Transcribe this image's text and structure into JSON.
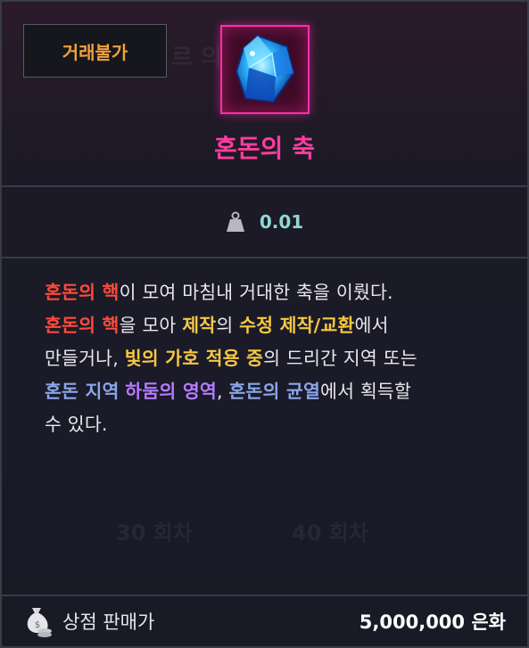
{
  "header": {
    "trade_badge": "거래불가",
    "item_name": "혼돈의 축",
    "item_icon": "blue-crystal-icon"
  },
  "colors": {
    "item_name": "#ff3c9e",
    "trade_badge": "#f0a23a",
    "weight": "#8fd8d6",
    "red_link": "#ff4a3a",
    "gold": "#f5c842",
    "chaos_blue": "#8aa6e8",
    "purple": "#b57cff"
  },
  "weight": {
    "icon": "weight-icon",
    "value": "0.01"
  },
  "description": [
    [
      {
        "text": "혼돈의 핵",
        "style": "red"
      },
      {
        "text": "이 모여 마침내 거대한 축을 이뤘다.",
        "style": "plain"
      }
    ],
    [
      {
        "text": "혼돈의 핵",
        "style": "red"
      },
      {
        "text": "을 모아 ",
        "style": "plain"
      },
      {
        "text": "제작",
        "style": "gold"
      },
      {
        "text": "의 ",
        "style": "plain"
      },
      {
        "text": "수정 제작/교환",
        "style": "gold"
      },
      {
        "text": "에서",
        "style": "plain"
      }
    ],
    [
      {
        "text": "만들거나, ",
        "style": "plain"
      },
      {
        "text": "빛의 가호 적용 중",
        "style": "gold"
      },
      {
        "text": "의 드리간 지역 또는",
        "style": "plain"
      }
    ],
    [
      {
        "text": "혼돈 지역",
        "style": "blue"
      },
      {
        "text": " ",
        "style": "plain"
      },
      {
        "text": "하둠의 영역",
        "style": "purple"
      },
      {
        "text": ", ",
        "style": "plain"
      },
      {
        "text": "혼돈의 균열",
        "style": "blue"
      },
      {
        "text": "에서 획득할",
        "style": "plain"
      }
    ],
    [
      {
        "text": "수 있다.",
        "style": "plain"
      }
    ]
  ],
  "footer": {
    "icon": "coin-bag-icon",
    "label": "상점 판매가",
    "price": "5,000,000 은화"
  }
}
